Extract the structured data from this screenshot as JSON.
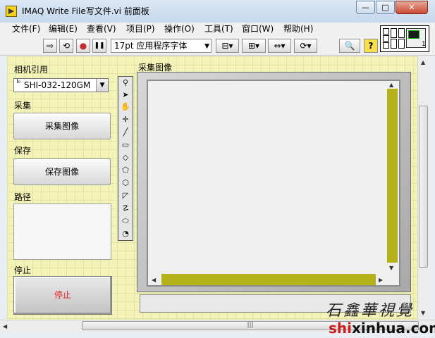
{
  "window": {
    "title": "IMAQ Write File写文件.vi 前面板",
    "min_glyph": "—",
    "max_glyph": "□",
    "close_glyph": "✕"
  },
  "menu": [
    "文件(F)",
    "编辑(E)",
    "查看(V)",
    "项目(P)",
    "操作(O)",
    "工具(T)",
    "窗口(W)",
    "帮助(H)"
  ],
  "toolbar": {
    "font": "17pt 应用程序字体",
    "font_dropdown_glyph": "▼",
    "run_glyph": "⇨",
    "run_continuous_glyph": "⟲",
    "abort_glyph": "●",
    "pause_glyph": "❚❚",
    "align_glyph": "⊟▾",
    "distribute_glyph": "⊞▾",
    "resize_glyph": "⇔▾",
    "reorder_glyph": "⟳▾",
    "search_glyph": "🔍",
    "help_glyph": "?"
  },
  "vi_icon": {
    "number": "1"
  },
  "controls": {
    "camera_label": "相机引用",
    "camera_radix": "I₀",
    "camera_value": "SHI-032-120GM",
    "camera_dropdown_glyph": "▼",
    "acquire_label": "采集",
    "acquire_button": "采集图像",
    "save_label": "保存",
    "save_button": "保存图像",
    "path_label": "路径",
    "path_value": "",
    "stop_label": "停止",
    "stop_button": "停止",
    "stop_text_color": "#e02020"
  },
  "image_display": {
    "label": "采集图像",
    "scrollbar_color": "#b4b41a",
    "up_arrow": "▲",
    "down_arrow": "▼",
    "left_arrow": "◀",
    "right_arrow": "▶"
  },
  "tools": [
    "⚲",
    "➤",
    "✋",
    "✛",
    "╱",
    "▭",
    "◇",
    "⬠",
    "⬡",
    "◸",
    "☡",
    "⬭",
    "◯",
    "◔"
  ],
  "scroll": {
    "up": "▲",
    "down": "▼",
    "left": "◀",
    "right": "▶",
    "grip": "|||"
  },
  "watermark": {
    "calligraphy": "石鑫華視覺",
    "url_prefix": "shi",
    "url_mid": "xinhua",
    "url_suffix": ".com"
  }
}
